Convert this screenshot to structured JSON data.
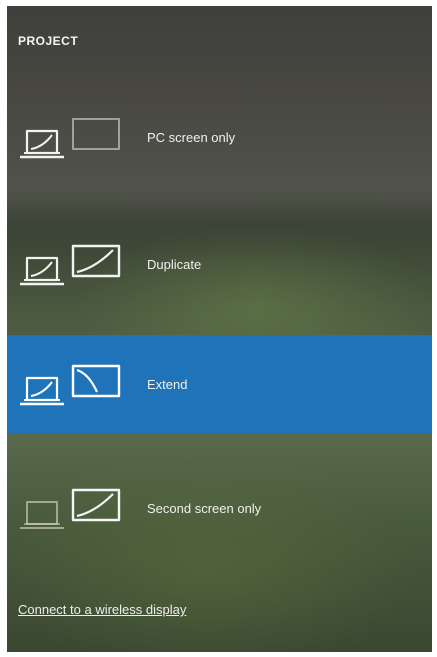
{
  "panel": {
    "title": "PROJECT",
    "options": [
      {
        "label": "PC screen only",
        "icon": "pc-screen-only-icon",
        "selected": false
      },
      {
        "label": "Duplicate",
        "icon": "duplicate-icon",
        "selected": false
      },
      {
        "label": "Extend",
        "icon": "extend-icon",
        "selected": true
      },
      {
        "label": "Second screen only",
        "icon": "second-screen-only-icon",
        "selected": false
      }
    ],
    "link_label": "Connect to a wireless display"
  },
  "colors": {
    "selected": "#1f74b9",
    "text": "#f0f0f0"
  }
}
